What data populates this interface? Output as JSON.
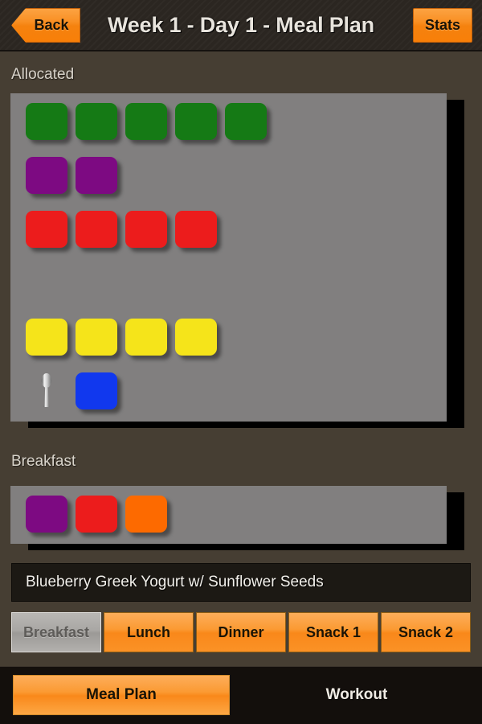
{
  "header": {
    "back_label": "Back",
    "title": "Week 1 - Day 1 - Meal Plan",
    "stats_label": "Stats"
  },
  "allocated": {
    "label": "Allocated",
    "rows": [
      {
        "color_name": "green",
        "color": "#157a15",
        "count": 5
      },
      {
        "color_name": "purple",
        "color": "#7d0a82",
        "count": 2
      },
      {
        "color_name": "red",
        "color": "#ec1c1c",
        "count": 4
      },
      {
        "color_name": "empty",
        "color": "",
        "count": 0
      },
      {
        "color_name": "yellow",
        "color": "#f5e41a",
        "count": 4
      },
      {
        "color_name": "teaspoon-blue",
        "color": "#1138ee",
        "count": 1,
        "has_spoon": true
      }
    ]
  },
  "breakfast_section": {
    "label": "Breakfast",
    "tiles": [
      {
        "color_name": "purple",
        "color": "#7d0a82"
      },
      {
        "color_name": "red",
        "color": "#ec1c1c"
      },
      {
        "color_name": "orange",
        "color": "#fd6a00"
      }
    ]
  },
  "meal_name": {
    "value": "Blueberry Greek Yogurt w/ Sunflower Seeds"
  },
  "meal_tabs": [
    {
      "label": "Breakfast",
      "active": true
    },
    {
      "label": "Lunch",
      "active": false
    },
    {
      "label": "Dinner",
      "active": false
    },
    {
      "label": "Snack 1",
      "active": false
    },
    {
      "label": "Snack 2",
      "active": false
    }
  ],
  "bottom_nav": {
    "meal_plan_label": "Meal Plan",
    "workout_label": "Workout"
  },
  "colors": {
    "background": "#463e33",
    "header_bg": "#2b2621",
    "panel_bg": "#817f7f",
    "accent_orange": "#f9881a",
    "field_bg": "#1c1914",
    "nav_bg": "#130f0c"
  }
}
